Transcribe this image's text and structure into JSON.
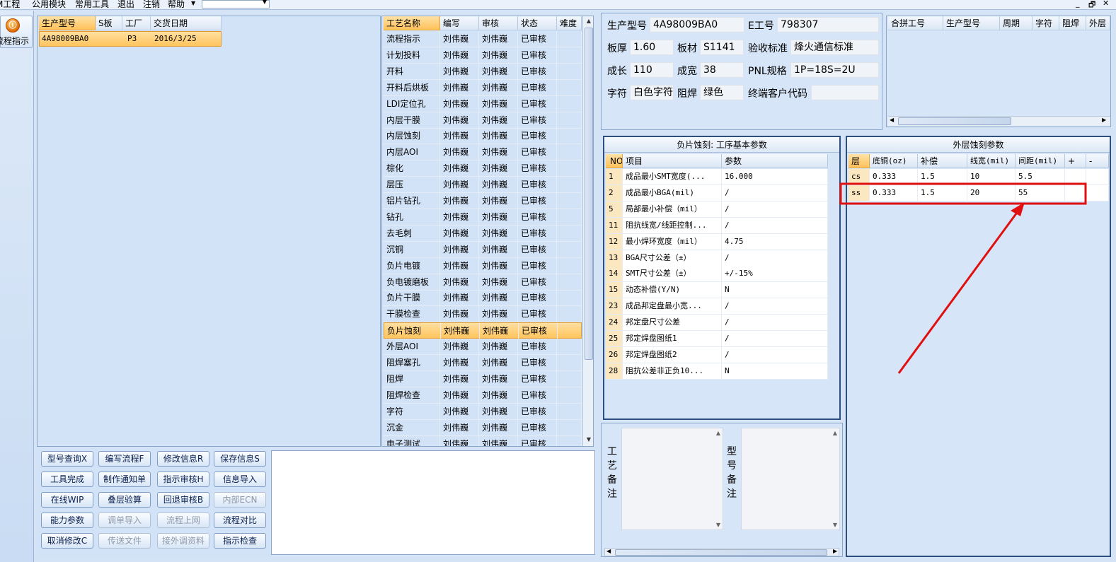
{
  "menu": {
    "items": [
      "M工程",
      "公用模块",
      "常用工具",
      "退出",
      "注销",
      "帮助"
    ],
    "combo_value": ""
  },
  "window_controls": [
    "_",
    "🗗",
    "✕"
  ],
  "left": {
    "flow_button_label": "流程指示"
  },
  "orders": {
    "columns": [
      "生产型号",
      "S板",
      "工厂",
      "交货日期"
    ],
    "rows": [
      {
        "model": "4A98009BA0",
        "s": "",
        "factory": "P3",
        "date": "2016/3/25"
      }
    ]
  },
  "processes": {
    "columns": [
      "工艺名称",
      "编写",
      "审核",
      "状态",
      "难度"
    ],
    "rows": [
      [
        "流程指示",
        "刘伟巍",
        "刘伟巍",
        "已审核",
        ""
      ],
      [
        "计划投料",
        "刘伟巍",
        "刘伟巍",
        "已审核",
        ""
      ],
      [
        "开料",
        "刘伟巍",
        "刘伟巍",
        "已审核",
        ""
      ],
      [
        "开料后烘板",
        "刘伟巍",
        "刘伟巍",
        "已审核",
        ""
      ],
      [
        "LDI定位孔",
        "刘伟巍",
        "刘伟巍",
        "已审核",
        ""
      ],
      [
        "内层干膜",
        "刘伟巍",
        "刘伟巍",
        "已审核",
        ""
      ],
      [
        "内层蚀刻",
        "刘伟巍",
        "刘伟巍",
        "已审核",
        ""
      ],
      [
        "内层AOI",
        "刘伟巍",
        "刘伟巍",
        "已审核",
        ""
      ],
      [
        "棕化",
        "刘伟巍",
        "刘伟巍",
        "已审核",
        ""
      ],
      [
        "层压",
        "刘伟巍",
        "刘伟巍",
        "已审核",
        ""
      ],
      [
        "铝片钻孔",
        "刘伟巍",
        "刘伟巍",
        "已审核",
        ""
      ],
      [
        "钻孔",
        "刘伟巍",
        "刘伟巍",
        "已审核",
        ""
      ],
      [
        "去毛刺",
        "刘伟巍",
        "刘伟巍",
        "已审核",
        ""
      ],
      [
        "沉铜",
        "刘伟巍",
        "刘伟巍",
        "已审核",
        ""
      ],
      [
        "负片电镀",
        "刘伟巍",
        "刘伟巍",
        "已审核",
        ""
      ],
      [
        "负电镀磨板",
        "刘伟巍",
        "刘伟巍",
        "已审核",
        ""
      ],
      [
        "负片干膜",
        "刘伟巍",
        "刘伟巍",
        "已审核",
        ""
      ],
      [
        "干膜检查",
        "刘伟巍",
        "刘伟巍",
        "已审核",
        ""
      ],
      [
        "负片蚀刻",
        "刘伟巍",
        "刘伟巍",
        "已审核",
        ""
      ],
      [
        "外层AOI",
        "刘伟巍",
        "刘伟巍",
        "已审核",
        ""
      ],
      [
        "阻焊塞孔",
        "刘伟巍",
        "刘伟巍",
        "已审核",
        ""
      ],
      [
        "阻焊",
        "刘伟巍",
        "刘伟巍",
        "已审核",
        ""
      ],
      [
        "阻焊检查",
        "刘伟巍",
        "刘伟巍",
        "已审核",
        ""
      ],
      [
        "字符",
        "刘伟巍",
        "刘伟巍",
        "已审核",
        ""
      ],
      [
        "沉金",
        "刘伟巍",
        "刘伟巍",
        "已审核",
        ""
      ],
      [
        "电子测试",
        "刘伟巍",
        "刘伟巍",
        "已审核",
        ""
      ]
    ],
    "selected_index": 18
  },
  "buttons": [
    [
      "型号查询X",
      "编写流程F",
      "修改信息R",
      "保存信息S"
    ],
    [
      "工具完成",
      "制作通知单",
      "指示审核H",
      "信息导入"
    ],
    [
      "在线WIP",
      "叠层验算",
      "回退审核B",
      "内部ECN"
    ],
    [
      "能力参数",
      "调单导入",
      "流程上网",
      "流程对比"
    ],
    [
      "取消修改C",
      "传送文件",
      "接外调资料",
      "指示检查"
    ]
  ],
  "disabled_buttons": [
    "内部ECN",
    "调单导入",
    "流程上网",
    "传送文件",
    "接外调资料"
  ],
  "info": {
    "row1": {
      "l1": "生产型号",
      "v1": "4A98009BA0",
      "l2": "E工号",
      "v2": "798307"
    },
    "row2": {
      "l1": "板厚",
      "v1": "1.60",
      "l2": "板材",
      "v2": "S1141",
      "l3": "验收标准",
      "v3": "烽火通信标准"
    },
    "row3": {
      "l1": "成长",
      "v1": "110",
      "l2": "成宽",
      "v2": "38",
      "l3": "PNL规格",
      "v3": "1P=18S=2U"
    },
    "row4": {
      "l1": "字符",
      "v1": "白色字符",
      "l2": "阻焊",
      "v2": "绿色",
      "l3": "终端客户代码",
      "v3": ""
    }
  },
  "merge": {
    "columns": [
      "合拼工号",
      "生产型号",
      "周期",
      "字符",
      "阻焊",
      "外层"
    ]
  },
  "params": {
    "title": "负片蚀刻: 工序基本参数",
    "columns": [
      "NO",
      "项目",
      "参数"
    ],
    "rows": [
      [
        "1",
        "成品最小SMT宽度(...",
        "16.000"
      ],
      [
        "2",
        "成品最小BGA(mil)",
        "/"
      ],
      [
        "5",
        "局部最小补偿（mil）",
        "/"
      ],
      [
        "11",
        "阻抗线宽/线距控制...",
        "/"
      ],
      [
        "12",
        "最小焊环宽度（mil）",
        "4.75"
      ],
      [
        "13",
        "BGA尺寸公差（±）",
        "/"
      ],
      [
        "14",
        "SMT尺寸公差（±）",
        "+/-15%"
      ],
      [
        "15",
        "动态补偿(Y/N)",
        "N"
      ],
      [
        "23",
        "成品邦定盘最小宽...",
        "/"
      ],
      [
        "24",
        "邦定盘尺寸公差",
        "/"
      ],
      [
        "25",
        "邦定焊盘图纸1",
        "/"
      ],
      [
        "26",
        "邦定焊盘图纸2",
        "/"
      ],
      [
        "28",
        "阻抗公差非正负10...",
        "N"
      ]
    ]
  },
  "outer": {
    "title": "外层蚀刻参数",
    "columns": [
      "层",
      "底铜(oz)",
      "补偿",
      "线宽(mil)",
      "间距(mil)",
      "+",
      "-"
    ],
    "rows": [
      [
        "cs",
        "0.333",
        "1.5",
        "10",
        "5.5"
      ],
      [
        "ss",
        "0.333",
        "1.5",
        "20",
        "55"
      ]
    ]
  },
  "remarks": {
    "process_label": "工艺备注",
    "model_label": "型号备注"
  },
  "colors": {
    "highlight": "#ffc15a",
    "annotation": "#e01010"
  }
}
